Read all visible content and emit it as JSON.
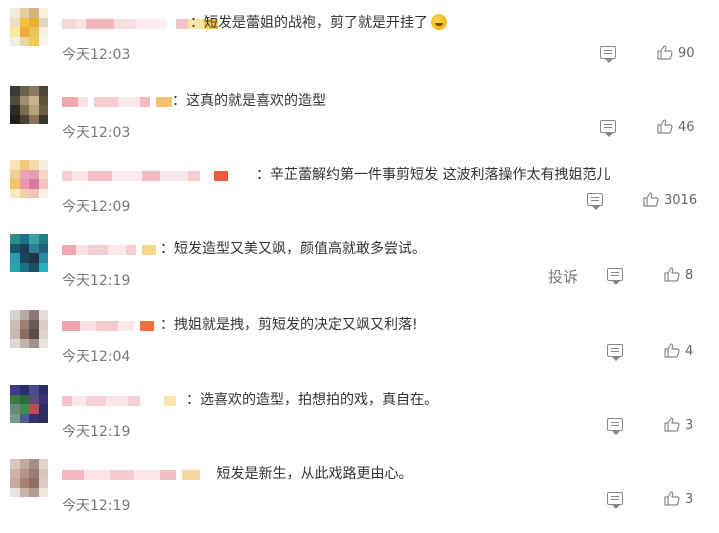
{
  "comments": [
    {
      "text": "短发是蕾姐的战袍，剪了就是开挂了",
      "time": "今天12:03",
      "likes": "90",
      "emoji": "laughing-crying-emoji",
      "avatar_colors": [
        "#f1ead9",
        "#e3cfa0",
        "#d4b37c",
        "#f5efe4",
        "#eadfc1",
        "#f0c33e",
        "#e7b02e",
        "#ded6c2",
        "#fbe6a0",
        "#f2a93b",
        "#e7c55b",
        "#f7f1e0",
        "#f4efe6",
        "#e9d6a8",
        "#f1c94c",
        "#faf6ec"
      ]
    },
    {
      "text": "这真的就是喜欢的造型",
      "time": "今天12:03",
      "likes": "46",
      "avatar_colors": [
        "#3a3a32",
        "#6b6048",
        "#8b7b5d",
        "#4b4636",
        "#544b3b",
        "#a08f6e",
        "#c8b38e",
        "#5d533f",
        "#2f2c25",
        "#7c6d52",
        "#b7a27b",
        "#6a5e47",
        "#1f1e1a",
        "#4a4335",
        "#857457",
        "#3b362c"
      ]
    },
    {
      "text": "辛芷蕾解约第一件事剪短发 这波利落操作太有拽姐范儿",
      "time": "今天12:09",
      "likes": "3016",
      "avatar_colors": [
        "#f7e3b3",
        "#f1c97a",
        "#f7d8a7",
        "#f6efe0",
        "#f1d08e",
        "#eaa4b8",
        "#e89cb3",
        "#f3d8c6",
        "#f2c56b",
        "#e996b2",
        "#d87aa0",
        "#f0c7b9",
        "#fbe9c6",
        "#f3cfa4",
        "#f1c2b8",
        "#f8efe5"
      ]
    },
    {
      "text": "短发造型又美又飒，颜值高就敢多尝试。",
      "time": "今天12:19",
      "likes": "8",
      "report_label": "投诉",
      "avatar_colors": [
        "#2e8c8d",
        "#1f6f86",
        "#3aa0a3",
        "#227c80",
        "#155b6e",
        "#1e3e55",
        "#2c7f94",
        "#1d6275",
        "#2b9cae",
        "#18455a",
        "#223546",
        "#2e8aa0",
        "#25a5b3",
        "#1d7087",
        "#1b4f63",
        "#2bb0c0"
      ]
    },
    {
      "text": "拽姐就是拽，剪短发的决定又飒又利落!",
      "time": "今天12:04",
      "likes": "4",
      "avatar_colors": [
        "#d8d1cd",
        "#b7a9a3",
        "#8a7a74",
        "#e5dfdb",
        "#cbbdb6",
        "#9d7f74",
        "#6e5a53",
        "#d6ccc8",
        "#c9b8b0",
        "#8c6c62",
        "#5c4a45",
        "#ddd3cf",
        "#e1d9d5",
        "#c2b3ad",
        "#a39189",
        "#eae4e1"
      ]
    },
    {
      "text": "选喜欢的造型，拍想拍的戏，真自在。",
      "time": "今天12:19",
      "likes": "3",
      "avatar_colors": [
        "#3b3f86",
        "#2b2e6c",
        "#4a4c95",
        "#2a2d63",
        "#3e7a40",
        "#2f6a3a",
        "#5a4b7a",
        "#3a3477",
        "#6b8a7a",
        "#3d8e49",
        "#bc4d58",
        "#2c2f66",
        "#7a9a8a",
        "#4c5d9a",
        "#36316e",
        "#2b2d5e"
      ]
    },
    {
      "text": "短发是新生，从此戏路更由心。",
      "time": "今天12:19",
      "likes": "3",
      "avatar_colors": [
        "#d9c8c1",
        "#c3aaa1",
        "#a98e86",
        "#e2d5d0",
        "#cdb3aa",
        "#b89288",
        "#9e7b70",
        "#d8c6bf",
        "#c7a89d",
        "#a87f72",
        "#8f6e64",
        "#dccbc5",
        "#ebe1dd",
        "#cbb2a9",
        "#b39b92",
        "#f0e7e3"
      ]
    }
  ]
}
